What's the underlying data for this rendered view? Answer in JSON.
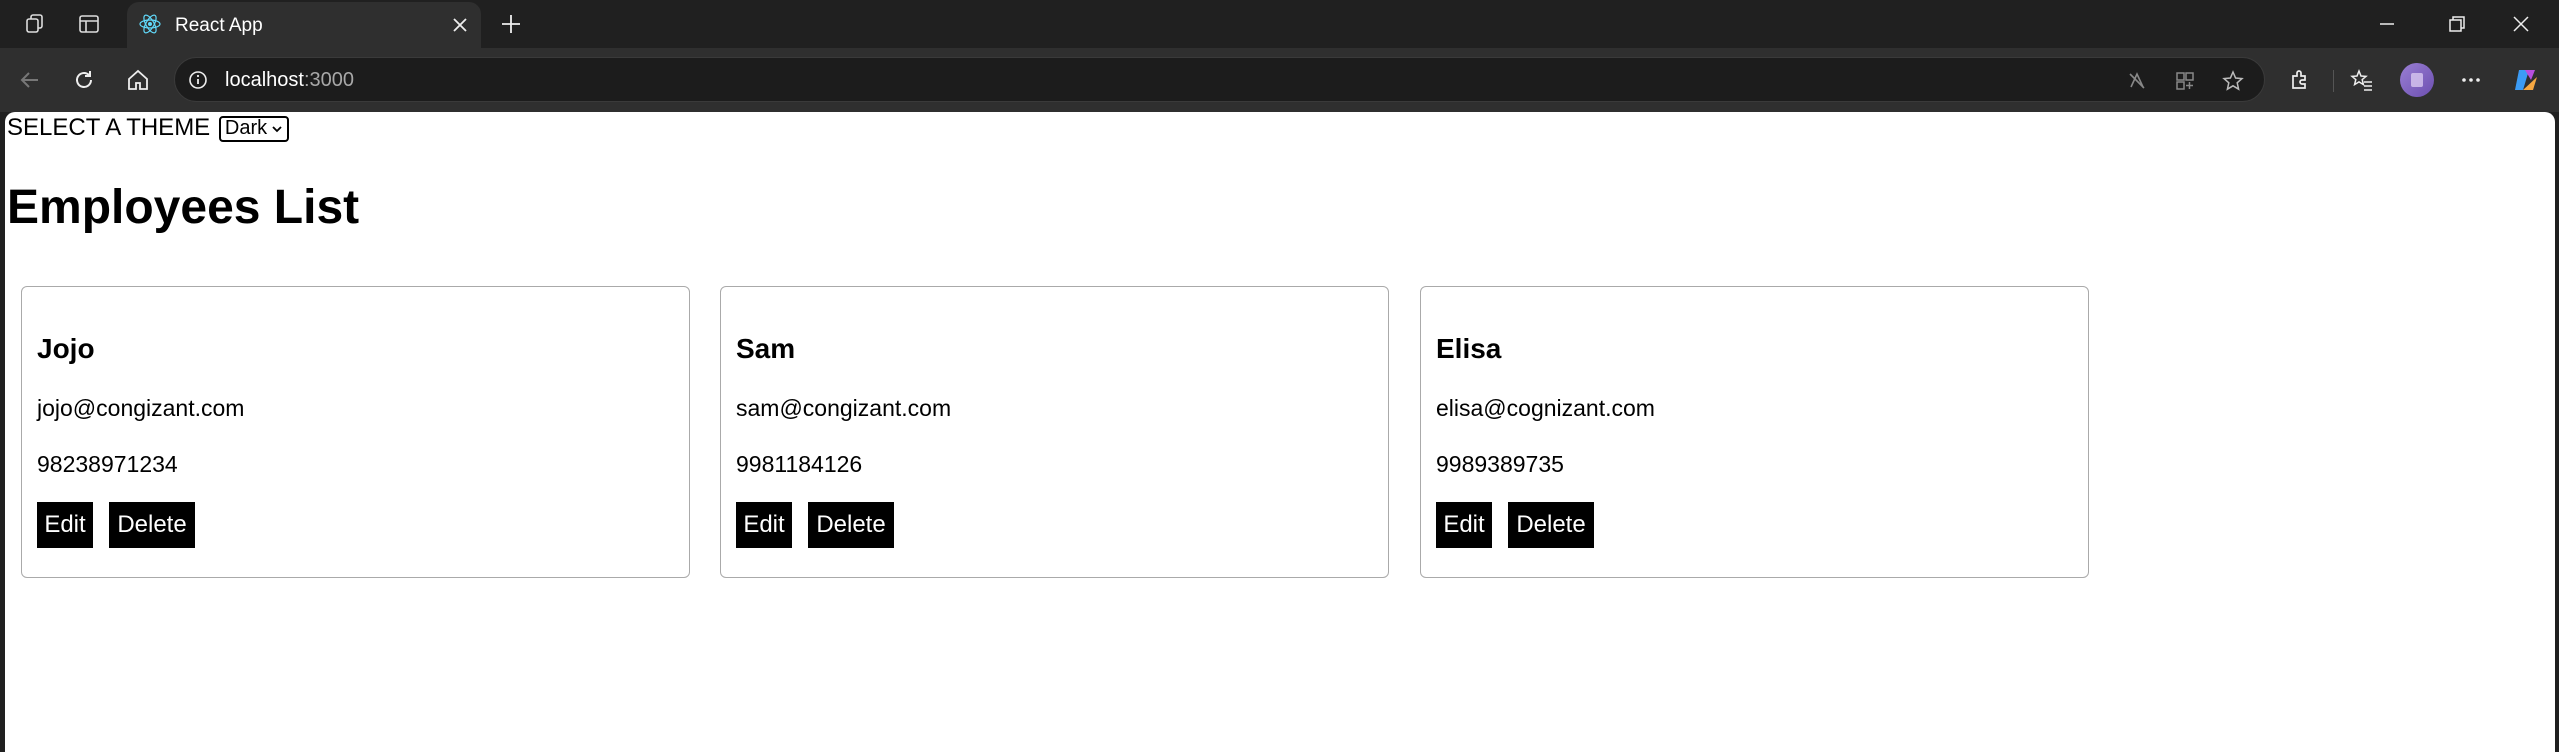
{
  "browser": {
    "tab_title": "React App",
    "url_host": "localhost",
    "url_port": ":3000"
  },
  "page": {
    "theme_label": "SELECT A THEME",
    "theme_value": "Dark",
    "title": "Employees List"
  },
  "buttons": {
    "edit_label": "Edit",
    "delete_label": "Delete"
  },
  "employees": [
    {
      "name": "Jojo",
      "email": "jojo@congizant.com",
      "phone": "98238971234"
    },
    {
      "name": "Sam",
      "email": "sam@congizant.com",
      "phone": "9981184126"
    },
    {
      "name": "Elisa",
      "email": "elisa@cognizant.com",
      "phone": "9989389735"
    }
  ],
  "colors": {
    "chrome_bg": "#202020",
    "toolbar_bg": "#2f2f2f",
    "button_bg": "#000000",
    "card_border": "#aaaaaa"
  }
}
